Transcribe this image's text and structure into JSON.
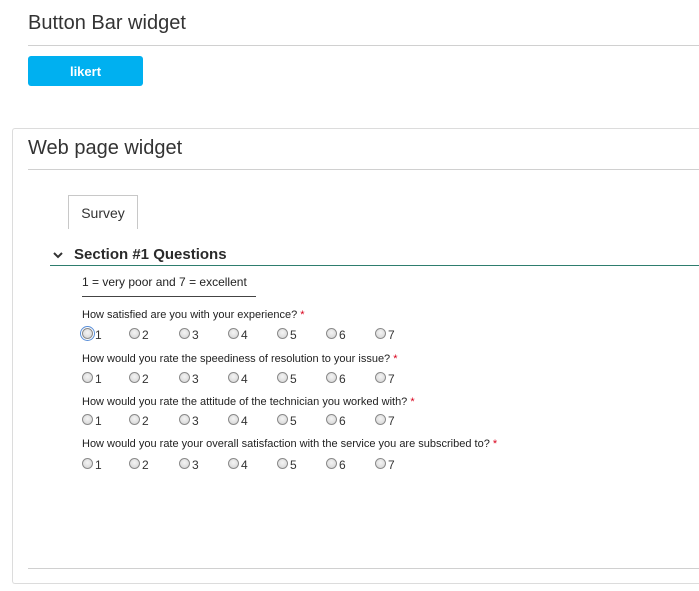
{
  "button_bar": {
    "title": "Button Bar widget",
    "likert_label": "likert"
  },
  "web_page": {
    "title": "Web page widget",
    "tabs": [
      {
        "label": "Survey"
      }
    ],
    "section": {
      "title": "Section #1 Questions",
      "scale_text": "1 = very poor and 7 = excellent",
      "questions": [
        {
          "text": "How satisfied are you with your experience?",
          "required": "*"
        },
        {
          "text": "How would you rate the speediness of resolution to your issue?",
          "required": "*"
        },
        {
          "text": "How would you rate the attitude of the technician you worked with?",
          "required": "*"
        },
        {
          "text": "How would you rate your overall satisfaction with the service you are subscribed to?",
          "required": "*"
        }
      ],
      "options": [
        "1",
        "2",
        "3",
        "4",
        "5",
        "6",
        "7"
      ]
    }
  },
  "colors": {
    "button": "#00b0f0",
    "section_rule": "#2e7d6e",
    "required": "#d9001b"
  }
}
